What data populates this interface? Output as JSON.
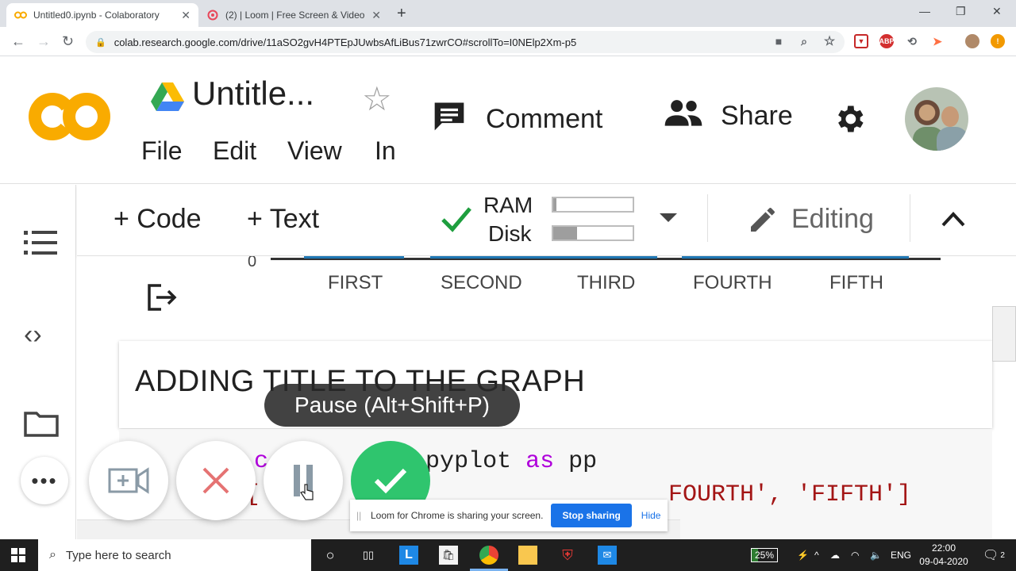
{
  "browser": {
    "tabs": [
      {
        "title": "Untitled0.ipynb - Colaboratory",
        "active": true
      },
      {
        "title": "(2) | Loom | Free Screen & Video",
        "active": false
      }
    ],
    "url": "colab.research.google.com/drive/11aSO2gvH4PTEpJUwbsAfLiBus71zwrCO#scrollTo=I0NElp2Xm-p5",
    "extensions": [
      "camera-icon",
      "zoom-icon",
      "star-icon",
      "ext-red-icon",
      "abp-icon",
      "sync-icon",
      "loom-ext-icon",
      "avatar-icon",
      "alert-icon"
    ]
  },
  "colab": {
    "logo_text": "CO",
    "notebook_title": "Untitle...",
    "menu": [
      "File",
      "Edit",
      "View",
      "In"
    ],
    "comment_label": "Comment",
    "share_label": "Share"
  },
  "toolbar": {
    "add_code": "+ Code",
    "add_text": "+ Text",
    "ram_label": "RAM",
    "disk_label": "Disk",
    "ram_usage": 0.04,
    "disk_usage": 0.3,
    "editing_label": "Editing"
  },
  "notebook": {
    "axis_zero": "0",
    "x_ticks": [
      "FIRST",
      "SECOND",
      "THIRD",
      "FOURTH",
      "FIFTH"
    ],
    "text_cell_heading": "ADDING TITLE TO THE GRAPH",
    "code_line1_a": "lib.pyplot ",
    "code_line1_kw": "as",
    "code_line1_b": " pp",
    "code_line2_left": "[",
    "code_line2_right": "FOURTH', 'FIFTH']"
  },
  "loom": {
    "pause_tooltip": "Pause (Alt+Shift+P)",
    "share_message": "Loom for Chrome is sharing your screen.",
    "stop_sharing": "Stop sharing",
    "hide": "Hide"
  },
  "taskbar": {
    "search_placeholder": "Type here to search",
    "battery": "25%",
    "language": "ENG",
    "time": "22:00",
    "date": "09-04-2020",
    "notifications": "2"
  },
  "colors": {
    "colab_orange": "#f9ab00",
    "loom_green": "#2fc56e",
    "bar_blue": "#1f77b4",
    "check_green": "#1e9e3e"
  }
}
